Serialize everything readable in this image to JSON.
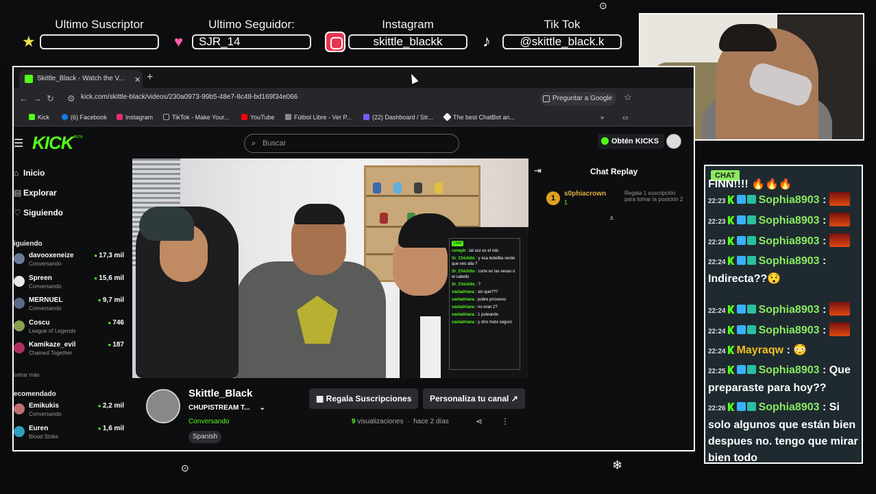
{
  "overlay": {
    "suscriptor": {
      "title": "Ultimo Suscriptor",
      "value": ""
    },
    "seguidor": {
      "title": "Ultimo Seguidor:",
      "value": "SJR_14"
    },
    "instagram": {
      "title": "Instagram",
      "value": "skittle_blackk"
    },
    "tiktok": {
      "title": "Tik Tok",
      "value": "@skittle_black.k"
    }
  },
  "browser": {
    "tab_title": "Skittle_Black - Watch the V...",
    "url": "kick.com/skittle-black/videos/230a0973-99b5-48e7-8c48-bd169f34e066",
    "google_btn": "Preguntar a Google",
    "bookmarks": [
      "Kick",
      "(6) Facebook",
      "Instagram",
      "TikTok - Make Your...",
      "YouTube",
      "Fútbol Libre - Ver P...",
      "(22) Dashboard / Str...",
      "The best ChatBot an..."
    ]
  },
  "kick": {
    "search_placeholder": "Buscar",
    "kicks_btn": "Obtén KICKS",
    "nav": [
      "Inicio",
      "Explorar",
      "Siguiendo"
    ],
    "following_header": "iguiendo",
    "following": [
      {
        "name": "davooxeneize",
        "sub": "Conversando",
        "count": "17,3 mil",
        "color": "#6a7a9a"
      },
      {
        "name": "Spreen",
        "sub": "Conversando",
        "count": "15,6 mil",
        "color": "#e8e8e8"
      },
      {
        "name": "MERNUEL",
        "sub": "Conversando",
        "count": "9,7 mil",
        "color": "#5a6a8a"
      },
      {
        "name": "Coscu",
        "sub": "League of Legends",
        "count": "746",
        "color": "#8aa050"
      },
      {
        "name": "Kamikaze_evil",
        "sub": "Chained Together",
        "count": "187",
        "color": "#b03060"
      }
    ],
    "show_more": "ostrar más",
    "recommended_header": "ecomendado",
    "recommended": [
      {
        "name": "Emikukis",
        "sub": "Conversando",
        "count": "2,2 mil",
        "color": "#c07070"
      },
      {
        "name": "Euren",
        "sub": "Blood Strike",
        "count": "1,6 mil",
        "color": "#30a0c0"
      }
    ],
    "chat_replay_title": "Chat Replay",
    "gifter": {
      "rank": "1",
      "name": "s0phiacrown",
      "count": "1",
      "msg": "Regala 1 suscripción para tomar la posición 2"
    },
    "channel": {
      "name": "Skittle_Black",
      "title": "CHUPISTREAM T...",
      "category": "Conversando",
      "tag": "Spanish",
      "btn_subs": "Regala Suscripciones",
      "btn_custom": "Personaliza tu canal",
      "views_count": "9",
      "views_label": "visualizaciones",
      "time": "hace 2 días"
    },
    "video_chat": {
      "badge": "CHAT",
      "messages": [
        {
          "user": "roneph",
          "text": ": tal vez es el mio"
        },
        {
          "user": "Sr_Chichito",
          "text": ": y esa botellita verde que veo alla ?"
        },
        {
          "user": "Sr_Chichito",
          "text": ": corte en las venas o el cabello"
        },
        {
          "user": "Sr_Chichito",
          "text": ": ?"
        },
        {
          "user": "vaviadriana",
          "text": ": sin que???"
        },
        {
          "user": "vaviadriana",
          "text": ": pobre prrooooo"
        },
        {
          "user": "vaviadriana",
          "text": ": no eran 2?"
        },
        {
          "user": "vaviadriana",
          "text": ": 1 puteando"
        },
        {
          "user": "vaviadriana",
          "text": ": y otro muto seguro"
        }
      ]
    }
  },
  "chat": {
    "badge": "CHAT",
    "first_line": "FINN!!!!",
    "messages": [
      {
        "time": "22:23",
        "user": "Sophia8903",
        "text": " :",
        "emote": true,
        "user_color": "green"
      },
      {
        "time": "22:23",
        "user": "Sophia8903",
        "text": " :",
        "emote": true,
        "user_color": "green"
      },
      {
        "time": "22:23",
        "user": "Sophia8903",
        "text": " :",
        "emote": true,
        "user_color": "green"
      },
      {
        "time": "22:24",
        "user": "Sophia8903",
        "text": " : Indirecta??😯",
        "emote": false,
        "user_color": "green"
      },
      {
        "time": "22:24",
        "user": "Sophia8903",
        "text": " :",
        "emote": true,
        "user_color": "green"
      },
      {
        "time": "22:24",
        "user": "Sophia8903",
        "text": " :",
        "emote": true,
        "user_color": "green"
      },
      {
        "time": "22:24",
        "user": "Mayraqw",
        "text": " : 😳",
        "emote": false,
        "user_color": "yellow"
      },
      {
        "time": "22:25",
        "user": "Sophia8903",
        "text": " : Que preparaste para hoy??",
        "emote": false,
        "user_color": "green"
      },
      {
        "time": "22:26",
        "user": "Sophia8903",
        "text": " : Si solo algunos que están bien despues no. tengo que mirar bien todo",
        "emote": false,
        "user_color": "green"
      }
    ]
  }
}
